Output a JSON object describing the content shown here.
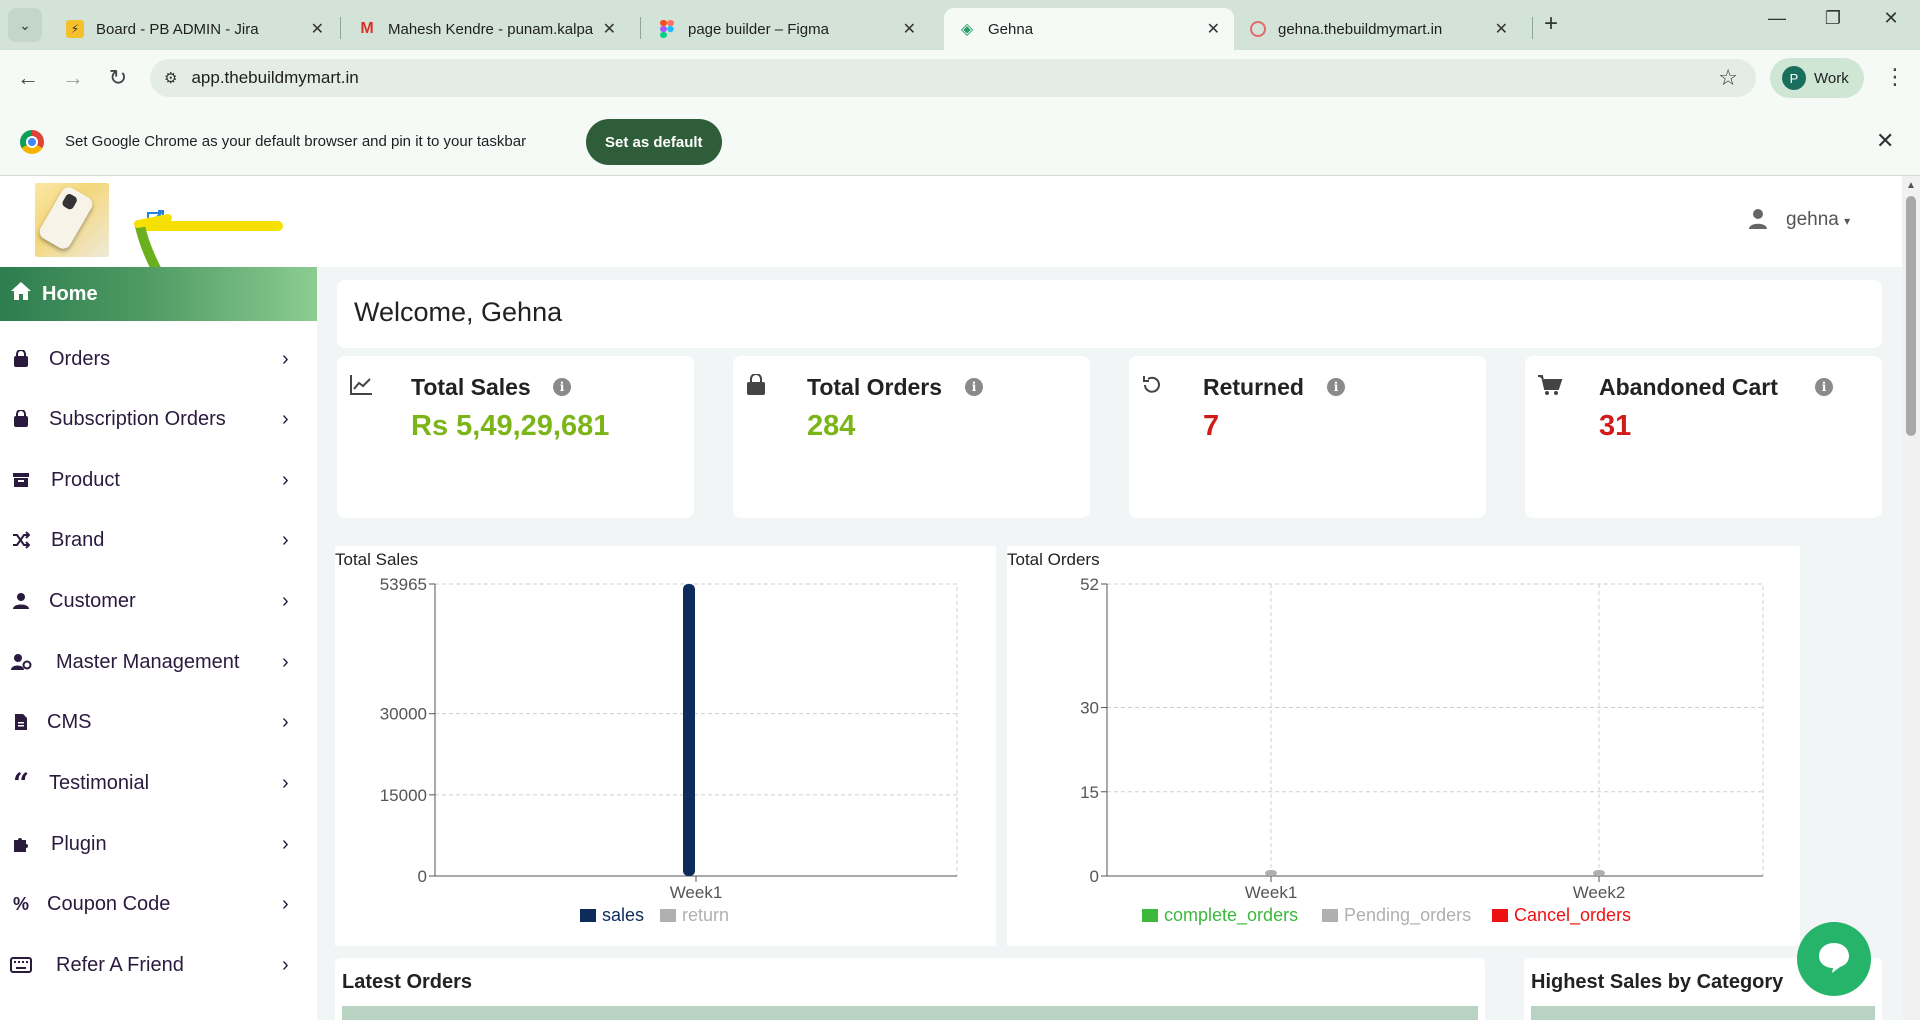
{
  "browser": {
    "tabs": [
      {
        "title": "Board - PB ADMIN - Jira",
        "icon": "jira-icon",
        "active": false
      },
      {
        "title": "Mahesh Kendre - punam.kalpana",
        "icon": "gmail-icon",
        "active": false
      },
      {
        "title": "page builder – Figma",
        "icon": "figma-icon",
        "active": false
      },
      {
        "title": "Gehna",
        "icon": "gehna-icon",
        "active": true
      },
      {
        "title": "gehna.thebuildmymart.in",
        "icon": "site-icon",
        "active": false
      }
    ],
    "url": "app.thebuildmymart.in",
    "profile_initial": "P",
    "profile_label": "Work",
    "infobar_text": "Set Google Chrome as your default browser and pin it to your taskbar",
    "infobar_button": "Set as default"
  },
  "header": {
    "username": "gehna"
  },
  "sidebar": {
    "home": "Home",
    "items": [
      {
        "label": "Orders",
        "icon": "bag-icon"
      },
      {
        "label": "Subscription Orders",
        "icon": "bag-icon"
      },
      {
        "label": "Product",
        "icon": "archive-icon"
      },
      {
        "label": "Brand",
        "icon": "shuffle-icon"
      },
      {
        "label": "Customer",
        "icon": "user-icon"
      },
      {
        "label": "Master Management",
        "icon": "user-gear-icon"
      },
      {
        "label": "CMS",
        "icon": "file-icon"
      },
      {
        "label": "Testimonial",
        "icon": "quote-icon"
      },
      {
        "label": "Plugin",
        "icon": "puzzle-icon"
      },
      {
        "label": "Coupon Code",
        "icon": "percent-icon"
      },
      {
        "label": "Refer A Friend",
        "icon": "keyboard-icon"
      }
    ]
  },
  "welcome": "Welcome, Gehna",
  "stats": [
    {
      "title": "Total Sales",
      "value": "Rs 5,49,29,681",
      "icon": "chart-line-icon",
      "color": "#7cb518"
    },
    {
      "title": "Total Orders",
      "value": "284",
      "icon": "bag-icon",
      "color": "#7cb518"
    },
    {
      "title": "Returned",
      "value": "7",
      "icon": "undo-icon",
      "color": "#d11a1a"
    },
    {
      "title": "Abandoned Cart",
      "value": "31",
      "icon": "cart-icon",
      "color": "#d11a1a"
    }
  ],
  "chart_data": [
    {
      "type": "bar",
      "title": "Total Sales",
      "categories": [
        "Week1"
      ],
      "series": [
        {
          "name": "sales",
          "values": [
            53965
          ],
          "color": "#0d2c5c"
        },
        {
          "name": "return",
          "values": [
            0
          ],
          "color": "#b0b0b0"
        }
      ],
      "ylim": [
        0,
        53965
      ],
      "yticks": [
        0,
        15000,
        30000,
        53965
      ],
      "grid": true,
      "legend": "bottom"
    },
    {
      "type": "bar",
      "title": "Total Orders",
      "categories": [
        "Week1",
        "Week2"
      ],
      "series": [
        {
          "name": "complete_orders",
          "values": [
            0,
            0
          ],
          "color": "#3cb83c"
        },
        {
          "name": "Pending_orders",
          "values": [
            1,
            0.3
          ],
          "color": "#b0b0b0"
        },
        {
          "name": "Cancel_orders",
          "values": [
            0,
            0
          ],
          "color": "#ee1111"
        }
      ],
      "ylim": [
        0,
        52
      ],
      "yticks": [
        0,
        15,
        30,
        52
      ],
      "grid": true,
      "legend": "bottom"
    }
  ],
  "panels": {
    "latest_orders": "Latest Orders",
    "highest_sales": "Highest Sales by Category"
  }
}
